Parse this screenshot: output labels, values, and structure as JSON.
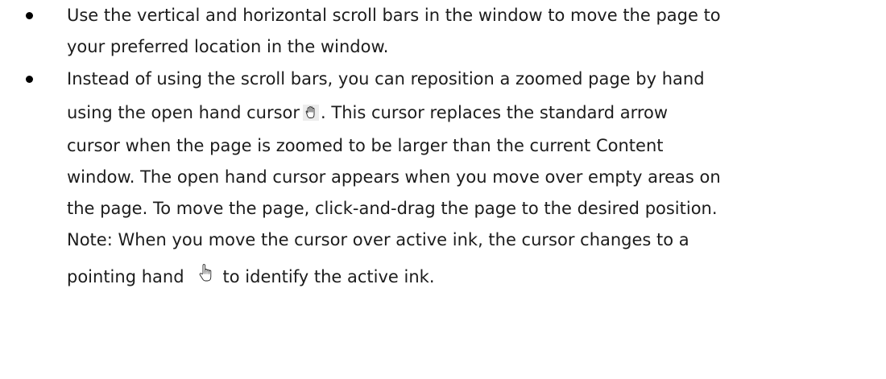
{
  "bullets": [
    {
      "lines": [
        "Use the vertical and horizontal scroll bars in the window to move the page to",
        "your preferred location in the window."
      ]
    },
    {
      "line1": "Instead of using the scroll bars, you can reposition a zoomed page by hand",
      "line2_before_icon": "using the open hand cursor",
      "line2_after_icon": ". This cursor replaces the standard arrow",
      "lines_middle": [
        "cursor when the page is zoomed to be larger than the current Content",
        "window. The open hand cursor appears when you move over empty areas on",
        "the page. To move the page, click-and-drag the page to the desired position.",
        "Note: When you move the cursor over active ink, the cursor changes to a"
      ],
      "last_before_icon": "pointing hand",
      "last_after_icon": "to identify the active ink."
    }
  ],
  "icons": {
    "open_hand": "open-hand-cursor-icon",
    "pointing_hand": "pointing-hand-cursor-icon"
  }
}
